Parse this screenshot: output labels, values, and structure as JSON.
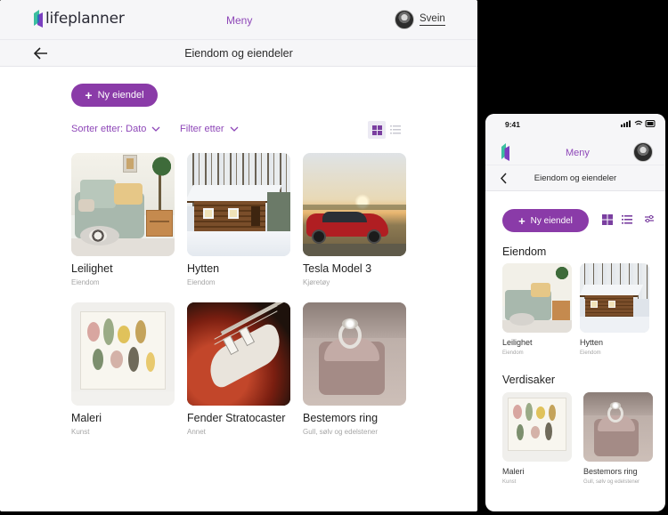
{
  "brand": {
    "name": "lifeplanner",
    "accent": "#8a3ba8",
    "link_color": "#8e47b8"
  },
  "desktop": {
    "menu": "Meny",
    "user_name": "Svein",
    "page_title": "Eiendom og eiendeler",
    "new_button": "Ny eiendel",
    "sort_label": "Sorter etter: Dato",
    "filter_label": "Filter etter",
    "cards": [
      {
        "title": "Leilighet",
        "category": "Eiendom",
        "image": "sofa-room"
      },
      {
        "title": "Hytten",
        "category": "Eiendom",
        "image": "log-cabin"
      },
      {
        "title": "Tesla Model 3",
        "category": "Kjøretøy",
        "image": "red-car"
      },
      {
        "title": "Maleri",
        "category": "Kunst",
        "image": "painting"
      },
      {
        "title": "Fender Stratocaster",
        "category": "Annet",
        "image": "guitar"
      },
      {
        "title": "Bestemors ring",
        "category": "Gull, sølv og edelstener",
        "image": "ring-box"
      }
    ]
  },
  "mobile": {
    "time": "9:41",
    "menu": "Meny",
    "page_title": "Eiendom og eiendeler",
    "new_button": "Ny eiendel",
    "sections": [
      {
        "heading": "Eiendom",
        "items": [
          {
            "title": "Leilighet",
            "category": "Eiendom"
          },
          {
            "title": "Hytten",
            "category": "Eiendom"
          }
        ]
      },
      {
        "heading": "Verdisaker",
        "items": [
          {
            "title": "Maleri",
            "category": "Kunst"
          },
          {
            "title": "Bestemors ring",
            "category": "Gull, sølv og edelstener"
          }
        ]
      }
    ]
  }
}
